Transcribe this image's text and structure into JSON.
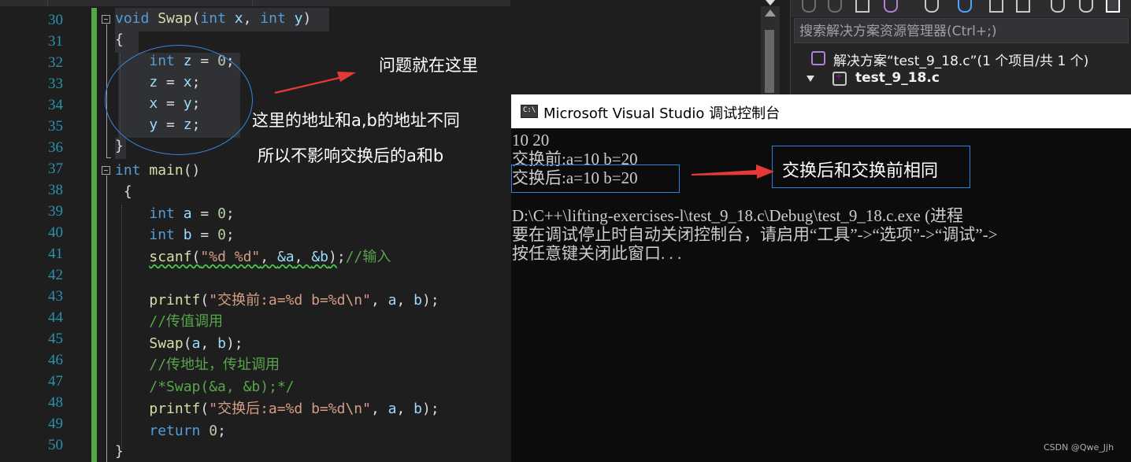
{
  "editor": {
    "line_numbers": [
      "30",
      "31",
      "32",
      "33",
      "34",
      "35",
      "36",
      "37",
      "38",
      "39",
      "40",
      "41",
      "42",
      "43",
      "44",
      "45",
      "46",
      "47",
      "48",
      "49",
      "50"
    ],
    "code": {
      "swap_void": "void",
      "swap_name": "Swap",
      "swap_int1": "int",
      "swap_x": "x",
      "swap_int2": "int",
      "swap_y": "y",
      "brace_open1": "{",
      "l32_int": "int",
      "l32_z": "z",
      "l32_rest": " = ",
      "l32_num": "0",
      "l32_end": ";",
      "l33_z": "z",
      "l33_x": "x",
      "l34_x": "x",
      "l34_y": "y",
      "l35_y": "y",
      "l35_z": "z",
      "brace_close1": "}",
      "main_int": "int",
      "main_name": "main",
      "main_parens": "()",
      "brace_open2": "{",
      "l39_int": "int",
      "l39_a": "a",
      "l39_num": "0",
      "l40_int": "int",
      "l40_b": "b",
      "l40_num": "0",
      "l41_fn": "scanf",
      "l41_str": "\"%d %d\"",
      "l41_a": "&a",
      "l41_b": "&b",
      "l41_cm": "//输入",
      "l43_fn": "printf",
      "l43_str": "\"交换前:a=%d b=%d\\n\"",
      "l43_a": "a",
      "l43_b": "b",
      "l44_cm": "//传值调用",
      "l45_fn": "Swap",
      "l45_a": "a",
      "l45_b": "b",
      "l46_cm": "//传地址，传址调用",
      "l47_cm": "/*Swap(&a, &b);*/",
      "l48_fn": "printf",
      "l48_str": "\"交换后:a=%d b=%d\\n\"",
      "l48_a": "a",
      "l48_b": "b",
      "l49_kw": "return",
      "l49_num": "0",
      "brace_close2": "}"
    }
  },
  "annotations": {
    "problem_here": "问题就在这里",
    "address_differs": "这里的地址和a,b的地址不同",
    "no_effect": "所以不影响交换后的a和b",
    "same_as_before": "交换后和交换前相同"
  },
  "solution_explorer": {
    "search_placeholder": "搜索解决方案资源管理器(Ctrl+;)",
    "solution_label": "解决方案“test_9_18.c”(1 个项目/共 1 个)",
    "project_label": "test_9_18.c"
  },
  "console": {
    "title": "Microsoft Visual Studio 调试控制台",
    "icon_text": "C:\\",
    "lines": [
      "10 20",
      "交换前:a=10 b=20",
      "交换后:a=10 b=20",
      "",
      "D:\\C++\\lifting-exercises-l\\test_9_18.c\\Debug\\test_9_18.c.exe (进程",
      "要在调试停止时自动关闭控制台，请启用“工具”->“选项”->“调试”->",
      "按任意键关闭此窗口. . ."
    ]
  },
  "watermark": "CSDN @Qwe_Jjh",
  "colors": {
    "editor_bg": "#1e1e1e",
    "line_number": "#2b91af",
    "keyword": "#569cd6",
    "function": "#dcdcaa",
    "identifier": "#9cdcfe",
    "string": "#d69d85",
    "comment": "#57a64a",
    "number": "#b5cea8",
    "arrow_red": "#e53935",
    "annotation_box": "#2f7fe0",
    "console_bg": "#0c0c0c"
  }
}
